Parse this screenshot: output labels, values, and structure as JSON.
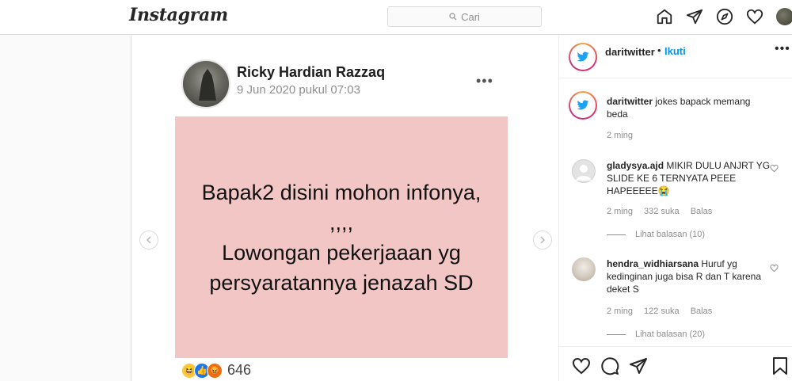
{
  "header": {
    "logo": "Instagram",
    "search_placeholder": "Cari"
  },
  "post": {
    "fb_author": "Ricky Hardian Razzaq",
    "fb_date": "9 Jun 2020 pukul 07:03",
    "fb_more": "•••",
    "image_lines": [
      "Bapak2 disini mohon infonya,",
      ",,,,",
      "Lowongan pekerjaaan yg",
      "persyaratannya jenazah SD"
    ],
    "reactions_count": "646"
  },
  "sidebar": {
    "username": "daritwitter",
    "separator": "•",
    "follow_label": "Ikuti",
    "more": "•••"
  },
  "comments": [
    {
      "user": "daritwitter",
      "text": "jokes bapack memang beda",
      "time": "2 ming"
    },
    {
      "user": "gladysya.ajd",
      "text": "MIKIR DULU ANJRT YG SLIDE KE 6 TERNYATA PEEE HAPEEEEE😭",
      "time": "2 ming",
      "likes": "332 suka",
      "reply_label": "Balas",
      "view_replies": "Lihat balasan (10)"
    },
    {
      "user": "hendra_widhiarsana",
      "text": "Huruf yg kedinginan juga bisa R dan T karena deket S",
      "time": "2 ming",
      "likes": "122 suka",
      "reply_label": "Balas",
      "view_replies": "Lihat balasan (20)"
    }
  ],
  "colors": {
    "accent": "#0095f6",
    "pink_card": "#f3c6c6",
    "border": "#dbdbdb"
  }
}
